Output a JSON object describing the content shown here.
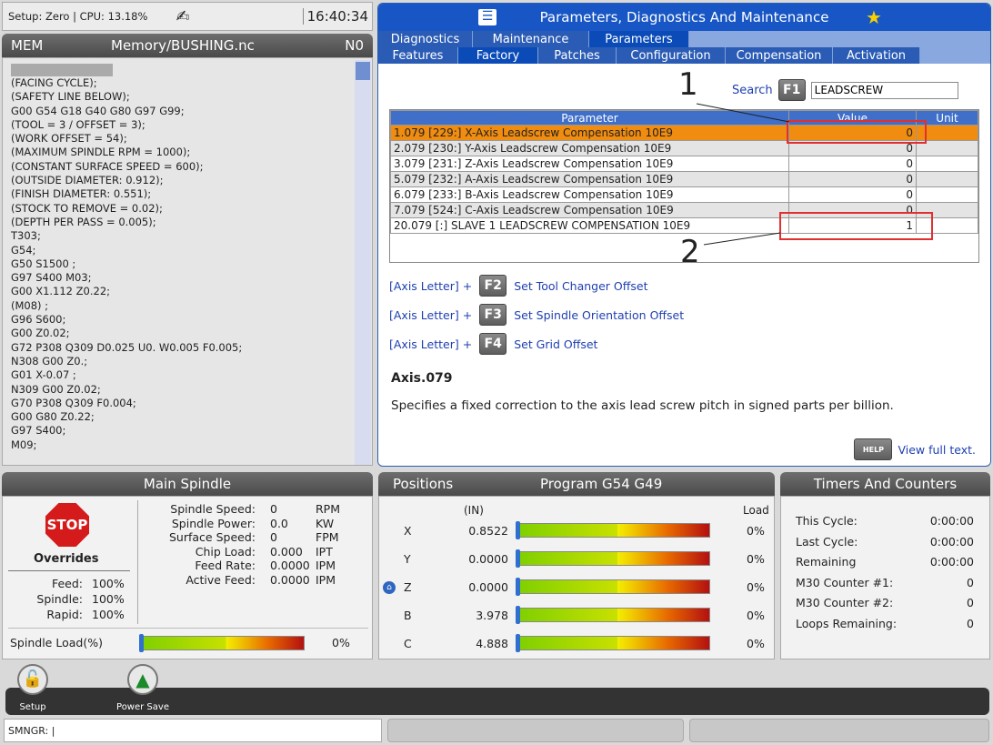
{
  "status": {
    "setup_cpu": "Setup: Zero | CPU: 13.18%",
    "time": "16:40:34"
  },
  "program": {
    "mode": "MEM",
    "path": "Memory/BUSHING.nc",
    "n": "N0",
    "lines": [
      "(FACING CYCLE);",
      "(SAFETY LINE BELOW);",
      "G00 G54 G18 G40 G80 G97 G99;",
      "(TOOL = 3 / OFFSET = 3);",
      "(WORK OFFSET = 54);",
      "(MAXIMUM SPINDLE RPM = 1000);",
      "(CONSTANT SURFACE SPEED = 600);",
      "(OUTSIDE DIAMETER: 0.912);",
      "(FINISH DIAMETER: 0.551);",
      "(STOCK TO REMOVE = 0.02);",
      "(DEPTH PER PASS = 0.005);",
      "T303;",
      "G54;",
      "G50 S1500 ;",
      "G97 S400 M03;",
      "G00 X1.112 Z0.22;",
      "(M08) ;",
      "G96 S600;",
      "G00 Z0.02;",
      "G72 P308 Q309 D0.025 U0. W0.005 F0.005;",
      "N308 G00 Z0.;",
      "G01 X-0.07 ;",
      "N309 G00 Z0.02;",
      "G70 P308 Q309 F0.004;",
      "G00 G80 Z0.22;",
      "G97 S400;",
      "M09;"
    ]
  },
  "params": {
    "title": "Parameters, Diagnostics And Maintenance",
    "tabs1": [
      "Diagnostics",
      "Maintenance",
      "Parameters"
    ],
    "tabs2": [
      "Features",
      "Factory",
      "Patches",
      "Configuration",
      "Compensation",
      "Activation"
    ],
    "search_label": "Search",
    "search_key": "F1",
    "search_value": "LEADSCREW",
    "col_param": "Parameter",
    "col_value": "Value",
    "col_unit": "Unit",
    "rows": [
      {
        "p": "1.079 [229:] X-Axis Leadscrew Compensation 10E9",
        "v": "0"
      },
      {
        "p": "2.079 [230:] Y-Axis Leadscrew Compensation 10E9",
        "v": "0"
      },
      {
        "p": "3.079 [231:] Z-Axis Leadscrew Compensation 10E9",
        "v": "0"
      },
      {
        "p": "5.079 [232:] A-Axis Leadscrew Compensation 10E9",
        "v": "0"
      },
      {
        "p": "6.079 [233:] B-Axis Leadscrew Compensation 10E9",
        "v": "0"
      },
      {
        "p": "7.079 [524:] C-Axis Leadscrew Compensation 10E9",
        "v": "0"
      },
      {
        "p": "20.079 [:] SLAVE 1 LEADSCREW COMPENSATION 10E9",
        "v": "1"
      }
    ],
    "callout1": "1",
    "callout2": "2",
    "axis_letter": "[Axis Letter] +",
    "f2": "F2",
    "f2_text": "Set Tool Changer Offset",
    "f3": "F3",
    "f3_text": "Set Spindle Orientation Offset",
    "f4": "F4",
    "f4_text": "Set Grid Offset",
    "desc_title": "Axis.079",
    "desc": "Specifies a fixed correction to the axis lead screw pitch in signed parts per billion.",
    "help_key": "HELP",
    "help_text": "View full text."
  },
  "spindle": {
    "title": "Main Spindle",
    "stop": "STOP",
    "overrides": "Overrides",
    "feed_l": "Feed:",
    "feed_v": "100%",
    "spindle_l": "Spindle:",
    "spindle_v": "100%",
    "rapid_l": "Rapid:",
    "rapid_v": "100%",
    "rows": [
      {
        "l": "Spindle Speed:",
        "v": "0",
        "u": "RPM"
      },
      {
        "l": "Spindle Power:",
        "v": "0.0",
        "u": "KW"
      },
      {
        "l": "Surface Speed:",
        "v": "0",
        "u": "FPM"
      },
      {
        "l": "Chip Load:",
        "v": "0.000",
        "u": "IPT"
      },
      {
        "l": "Feed Rate:",
        "v": "0.0000",
        "u": "IPM"
      },
      {
        "l": "Active Feed:",
        "v": "0.0000",
        "u": "IPM"
      }
    ],
    "load_label": "Spindle Load(%)",
    "load_value": "0%"
  },
  "positions": {
    "title": "Positions",
    "program": "Program G54 G49",
    "unit": "(IN)",
    "load": "Load",
    "axes": [
      {
        "a": "X",
        "v": "0.8522",
        "l": "0%"
      },
      {
        "a": "Y",
        "v": "0.0000",
        "l": "0%"
      },
      {
        "a": "Z",
        "v": "0.0000",
        "l": "0%"
      },
      {
        "a": "B",
        "v": "3.978",
        "l": "0%"
      },
      {
        "a": "C",
        "v": "4.888",
        "l": "0%"
      }
    ]
  },
  "timers": {
    "title": "Timers And Counters",
    "rows": [
      {
        "l": "This Cycle:",
        "v": "0:00:00"
      },
      {
        "l": "Last Cycle:",
        "v": "0:00:00"
      },
      {
        "l": "Remaining",
        "v": "0:00:00"
      },
      {
        "l": "M30 Counter #1:",
        "v": "0"
      },
      {
        "l": "M30 Counter #2:",
        "v": "0"
      },
      {
        "l": "Loops Remaining:",
        "v": "0"
      }
    ]
  },
  "dock": {
    "setup": "Setup",
    "power": "Power Save"
  },
  "cmd": {
    "prompt": "SMNGR: |"
  }
}
